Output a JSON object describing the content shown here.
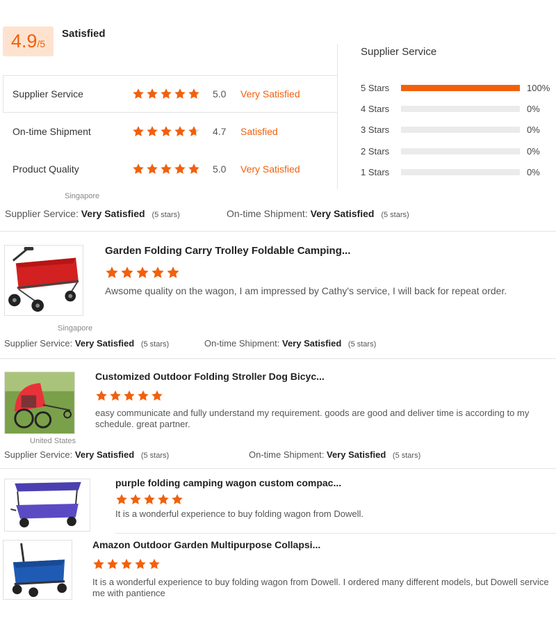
{
  "summary": {
    "score": "4.9",
    "score_suffix": "/5",
    "label": "Satisfied"
  },
  "metrics": [
    {
      "name": "Supplier Service",
      "rating": 5.0,
      "value": "5.0",
      "text": "Very Satisfied"
    },
    {
      "name": "On-time Shipment",
      "rating": 4.7,
      "value": "4.7",
      "text": "Satisfied"
    },
    {
      "name": "Product Quality",
      "rating": 5.0,
      "value": "5.0",
      "text": "Very Satisfied"
    }
  ],
  "distribution": {
    "title": "Supplier Service",
    "rows": [
      {
        "label": "5  Stars",
        "fraction": 1.0,
        "pct": "100%"
      },
      {
        "label": "4  Stars",
        "fraction": 0.0,
        "pct": "0%"
      },
      {
        "label": "3  Stars",
        "fraction": 0.0,
        "pct": "0%"
      },
      {
        "label": "2  Stars",
        "fraction": 0.0,
        "pct": "0%"
      },
      {
        "label": "1  Stars",
        "fraction": 0.0,
        "pct": "0%"
      }
    ]
  },
  "reviews": [
    {
      "country": "Singapore",
      "svc_label": "Supplier Service:",
      "svc_value": "Very Satisfied",
      "svc_stars": "(5 stars)",
      "ship_label": "On-time Shipment:",
      "ship_value": "Very Satisfied",
      "ship_stars": "(5 stars)",
      "title": "Garden Folding Carry Trolley Foldable Camping...",
      "rating": 5,
      "text": "Awsome quality on the wagon, I am impressed by Cathy's service, I will back for repeat order."
    },
    {
      "country": "Singapore",
      "svc_label": "Supplier Service:",
      "svc_value": "Very Satisfied",
      "svc_stars": "(5 stars)",
      "ship_label": "On-time Shipment:",
      "ship_value": "Very Satisfied",
      "ship_stars": "(5 stars)",
      "title": "Customized Outdoor Folding Stroller Dog Bicyc...",
      "rating": 5,
      "text": "easy communicate and fully understand my requirement. goods are good and deliver time is according to my schedule. great partner."
    },
    {
      "country": "United States",
      "svc_label": "Supplier Service:",
      "svc_value": "Very Satisfied",
      "svc_stars": "(5 stars)",
      "ship_label": "On-time Shipment:",
      "ship_value": "Very Satisfied",
      "ship_stars": "(5 stars)",
      "title": "purple folding camping wagon custom compac...",
      "rating": 5,
      "text": "It is a wonderful experience to buy folding wagon from Dowell."
    },
    {
      "title": "Amazon Outdoor Garden Multipurpose Collapsi...",
      "rating": 5,
      "text": "It is a wonderful experience to buy folding wagon from Dowell. I ordered many different models, but Dowell service me with pantience"
    }
  ],
  "colors": {
    "accent": "#f2600c",
    "badge_bg": "#fde3cf",
    "bar_bg": "#ebebeb",
    "star_empty": "#d9d9d9"
  },
  "icons": {
    "star": "star-icon"
  }
}
